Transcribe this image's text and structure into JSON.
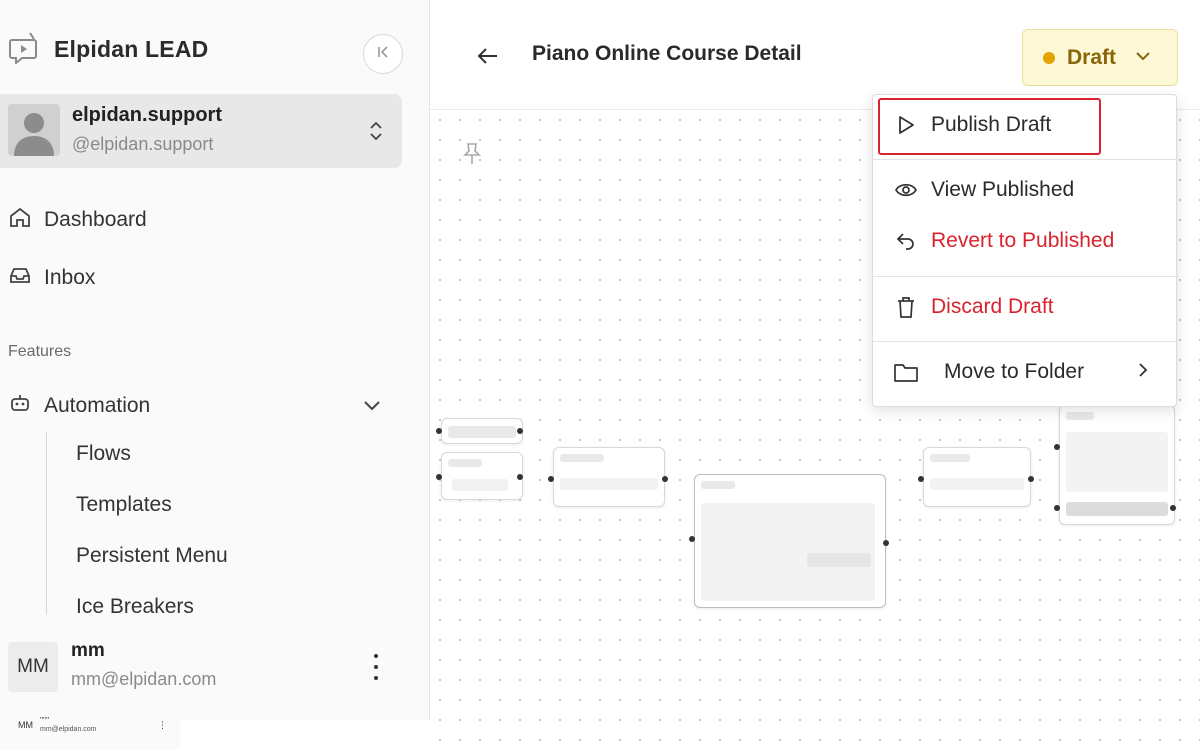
{
  "app": {
    "title": "Elpidan LEAD"
  },
  "account": {
    "name": "elpidan.support",
    "handle": "@elpidan.support"
  },
  "nav": {
    "dashboard": "Dashboard",
    "inbox": "Inbox",
    "features_label": "Features",
    "automation": "Automation",
    "subitems": [
      "Flows",
      "Templates",
      "Persistent Menu",
      "Ice Breakers"
    ]
  },
  "user": {
    "initials": "MM",
    "name": "mm",
    "email": "mm@elpidan.com"
  },
  "mini_footer": {
    "initials": "MM",
    "name": "''''''",
    "email": "mm@elpidan.com"
  },
  "header": {
    "title": "Piano Online Course Detail",
    "status": "Draft"
  },
  "dropdown": {
    "publish": "Publish Draft",
    "view_published": "View Published",
    "revert": "Revert to Published",
    "discard": "Discard Draft",
    "move": "Move to Folder"
  },
  "colors": {
    "status_bg": "#fdf8d6",
    "status_text": "#8a6408",
    "status_dot": "#e3a400",
    "danger": "#d9232e"
  }
}
